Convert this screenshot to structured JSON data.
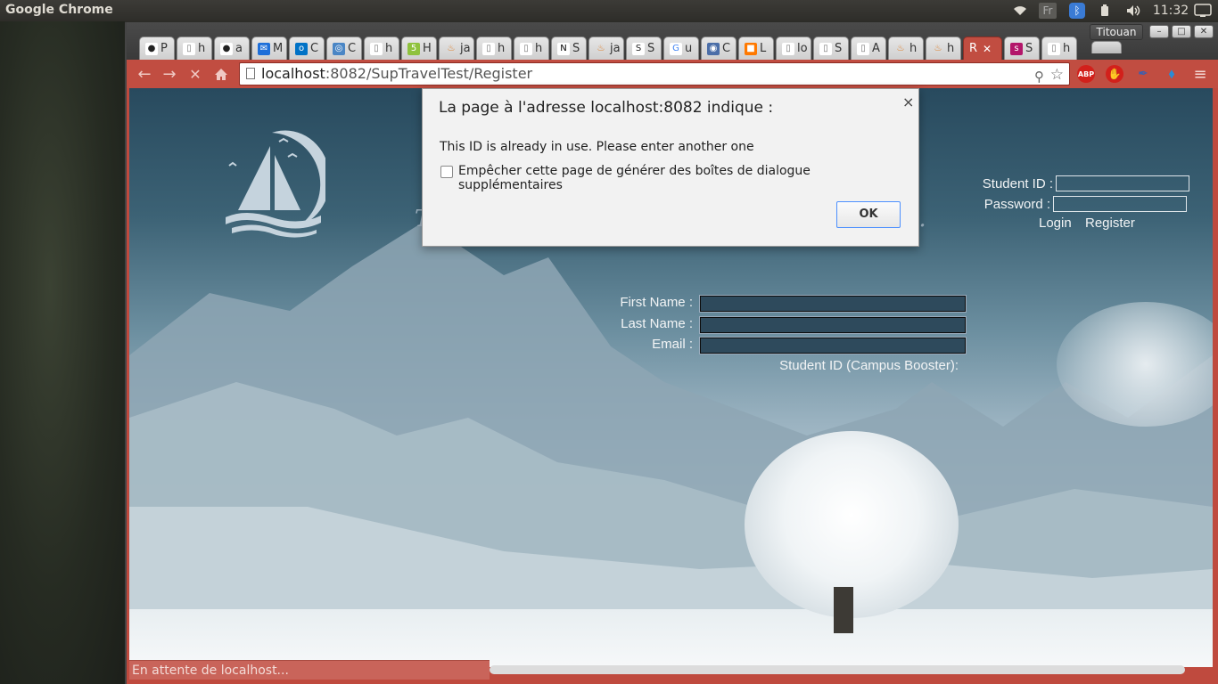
{
  "panel": {
    "app_title": "Google Chrome",
    "time": "11:32",
    "lang": "Fr"
  },
  "browser": {
    "profile_name": "Titouan",
    "tabs": [
      {
        "icon": "github-icon",
        "label": "P",
        "active": false
      },
      {
        "icon": "page-icon",
        "label": "h",
        "active": false
      },
      {
        "icon": "github-icon",
        "label": "a",
        "active": false
      },
      {
        "icon": "mail-icon",
        "label": "M",
        "active": false
      },
      {
        "icon": "outlook-icon",
        "label": "C",
        "active": false
      },
      {
        "icon": "globe-icon",
        "label": "C",
        "active": false
      },
      {
        "icon": "page-icon",
        "label": "h",
        "active": false
      },
      {
        "icon": "html5-icon",
        "label": "H",
        "active": false
      },
      {
        "icon": "java-icon",
        "label": "ja",
        "active": false
      },
      {
        "icon": "page-icon",
        "label": "h",
        "active": false
      },
      {
        "icon": "page-icon",
        "label": "h",
        "active": false
      },
      {
        "icon": "notion-icon",
        "label": "S",
        "active": false
      },
      {
        "icon": "java-icon",
        "label": "ja",
        "active": false
      },
      {
        "icon": "sql-icon",
        "label": "S",
        "active": false
      },
      {
        "icon": "google-icon",
        "label": "u",
        "active": false
      },
      {
        "icon": "db-icon",
        "label": "C",
        "active": false
      },
      {
        "icon": "orange-icon",
        "label": "L",
        "active": false
      },
      {
        "icon": "page-icon",
        "label": "lo",
        "active": false
      },
      {
        "icon": "page-icon",
        "label": "S",
        "active": false
      },
      {
        "icon": "page-icon",
        "label": "A",
        "active": false
      },
      {
        "icon": "java-icon",
        "label": "h",
        "active": false
      },
      {
        "icon": "java-icon",
        "label": "h",
        "active": false
      },
      {
        "icon": "page-icon",
        "label": "R",
        "active": true
      },
      {
        "icon": "sncf-icon",
        "label": "S",
        "active": false
      },
      {
        "icon": "page-icon",
        "label": "h",
        "active": false
      }
    ],
    "url_host": "localhost",
    "url_path": ":8082/SupTravelTest/Register",
    "status_text": "En attente de localhost...",
    "extensions": {
      "abp": "ABP"
    }
  },
  "page": {
    "tagline_start": "T",
    "tagline_end": "s.",
    "login": {
      "student_id_label": "Student ID :",
      "password_label": "Password :",
      "login_link": "Login",
      "register_link": "Register"
    },
    "register": {
      "first_name_label": "First Name :",
      "last_name_label": "Last Name :",
      "email_label": "Email :",
      "student_id_label": "Student ID (Campus Booster):"
    }
  },
  "dialog": {
    "title": "La page à l'adresse localhost:8082 indique :",
    "message": "This ID is already in use. Please enter another one",
    "checkbox_label": "Empêcher cette page de générer des boîtes de dialogue supplémentaires",
    "ok_label": "OK"
  }
}
